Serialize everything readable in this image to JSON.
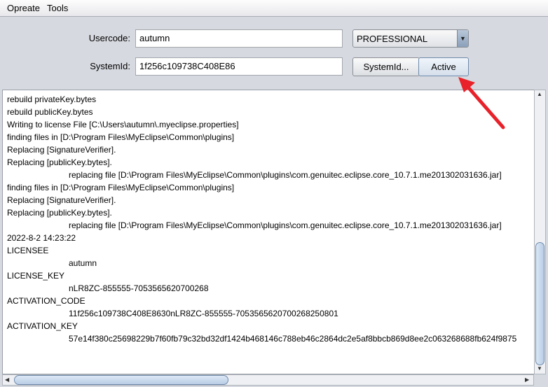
{
  "menu": [
    "Opreate",
    "Tools"
  ],
  "form": {
    "usercode_label": "Usercode:",
    "usercode_value": "autumn",
    "systemid_label": "SystemId:",
    "systemid_value": "1f256c109738C408E86",
    "edition": "PROFESSIONAL",
    "systemid_button": "SystemId...",
    "active_button": "Active"
  },
  "log": [
    {
      "text": "rebuild privateKey.bytes",
      "indent": false
    },
    {
      "text": "rebuild publicKey.bytes",
      "indent": false
    },
    {
      "text": "Writing to license File [C:\\Users\\autumn\\.myeclipse.properties]",
      "indent": false
    },
    {
      "text": "finding files in [D:\\Program Files\\MyEclipse\\Common\\plugins]",
      "indent": false
    },
    {
      "text": "Replacing [SignatureVerifier].",
      "indent": false
    },
    {
      "text": "Replacing [publicKey.bytes].",
      "indent": false
    },
    {
      "text": "replacing file [D:\\Program Files\\MyEclipse\\Common\\plugins\\com.genuitec.eclipse.core_10.7.1.me201302031636.jar]",
      "indent": true
    },
    {
      "text": "finding files in [D:\\Program Files\\MyEclipse\\Common\\plugins]",
      "indent": false
    },
    {
      "text": "Replacing [SignatureVerifier].",
      "indent": false
    },
    {
      "text": "Replacing [publicKey.bytes].",
      "indent": false
    },
    {
      "text": "replacing file [D:\\Program Files\\MyEclipse\\Common\\plugins\\com.genuitec.eclipse.core_10.7.1.me201302031636.jar]",
      "indent": true
    },
    {
      "text": "2022-8-2 14:23:22",
      "indent": false
    },
    {
      "text": "LICENSEE",
      "indent": false
    },
    {
      "text": "autumn",
      "indent": true
    },
    {
      "text": "LICENSE_KEY",
      "indent": false
    },
    {
      "text": "nLR8ZC-855555-7053565620700268",
      "indent": true
    },
    {
      "text": "ACTIVATION_CODE",
      "indent": false
    },
    {
      "text": "11f256c109738C408E8630nLR8ZC-855555-7053565620700268250801",
      "indent": true
    },
    {
      "text": "ACTIVATION_KEY",
      "indent": false
    },
    {
      "text": "57e14f380c25698229b7f60fb79c32bd32df1424b468146c788eb46c2864dc2e5af8bbcb869d8ee2c063268688fb624f9875",
      "indent": true
    }
  ],
  "annotation_color": "#e8212a"
}
